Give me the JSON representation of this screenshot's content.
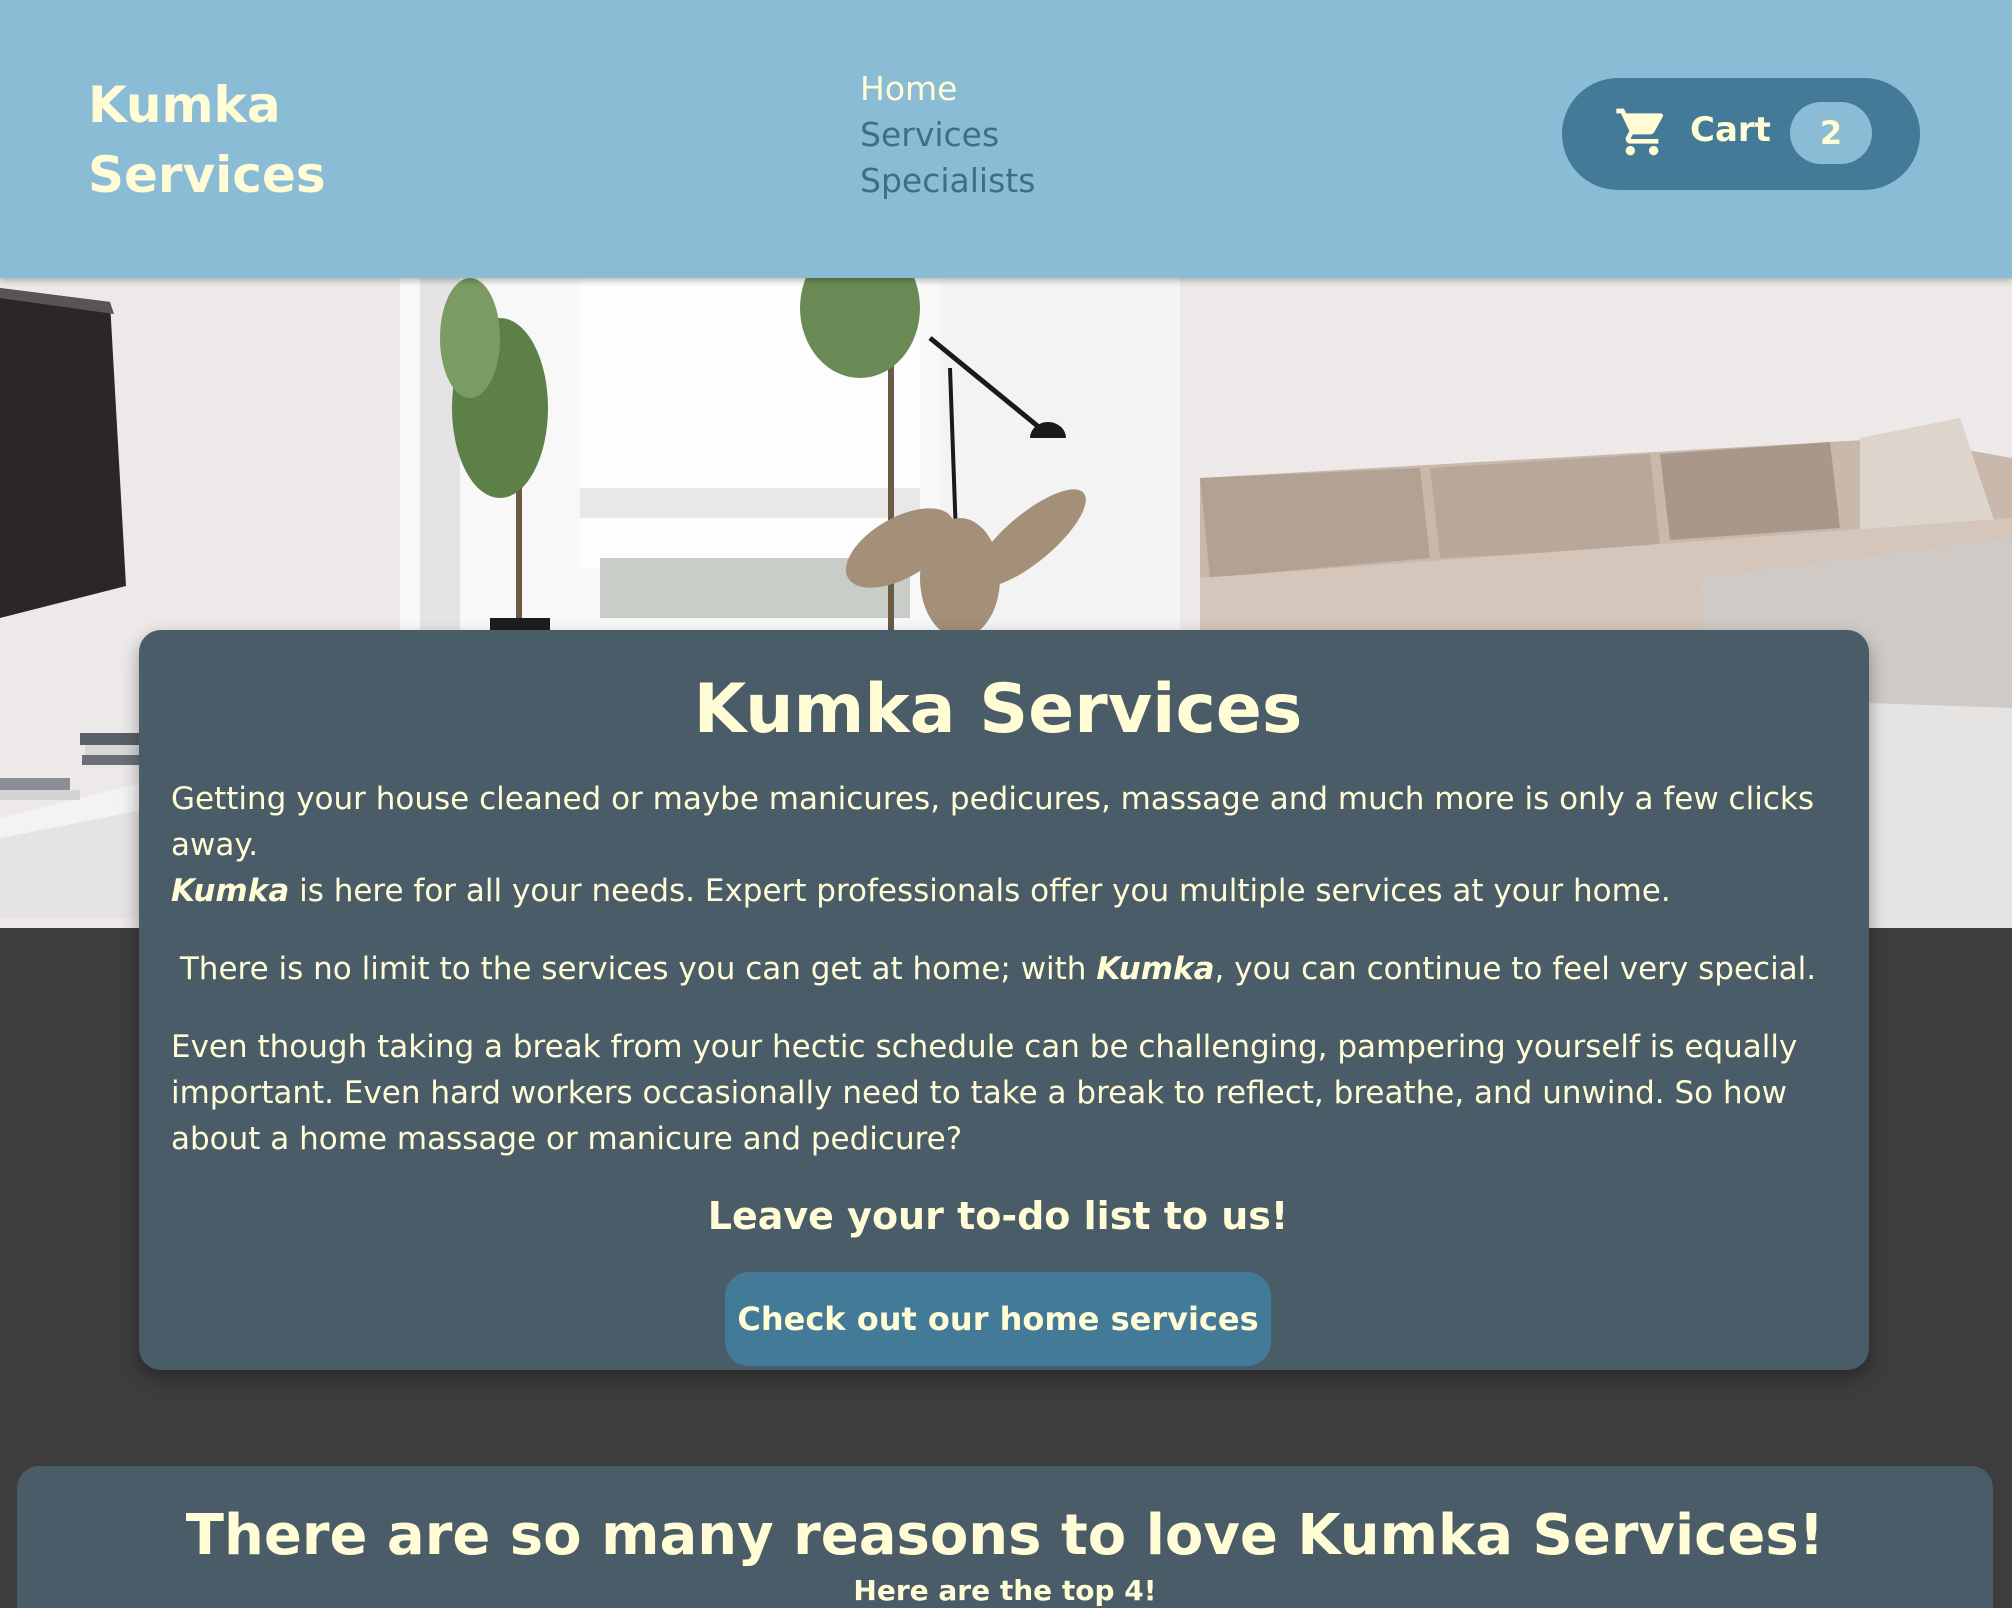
{
  "header": {
    "brand_line1": "Kumka",
    "brand_line2": "Services",
    "nav": [
      "Home",
      "Services",
      "Specialists"
    ],
    "cart_label": "Cart",
    "cart_count": "2"
  },
  "intro": {
    "title": "Kumka Services",
    "p1": "Getting your house cleaned or maybe manicures, pedicures, massage and much more is only a few clicks away.",
    "p1_brand": "Kumka",
    "p1_rest": " is here for all your needs. Expert professionals offer you multiple services at your home.",
    "p2_start": "There is no limit to the services you can get at home; with ",
    "p2_brand": "Kumka",
    "p2_end": ", you can continue to feel very special.",
    "p3": "Even though taking a break from your hectic schedule can be challenging, pampering yourself is equally important. Even hard workers occasionally need to take a break to reflect, breathe, and unwind. So how about a home massage or manicure and pedicure?",
    "tagline": "Leave your to-do list to us!",
    "cta_label": "Check out our home services"
  },
  "reasons": {
    "title": "There are so many reasons to love Kumka Services!",
    "subtitle": "Here are the top 4!"
  },
  "colors": {
    "header_bg": "#8abcd6",
    "accent": "#437a98",
    "card_bg": "#4a5c68",
    "page_bg": "#3d3d3d",
    "text_cream": "#fffcd6"
  }
}
